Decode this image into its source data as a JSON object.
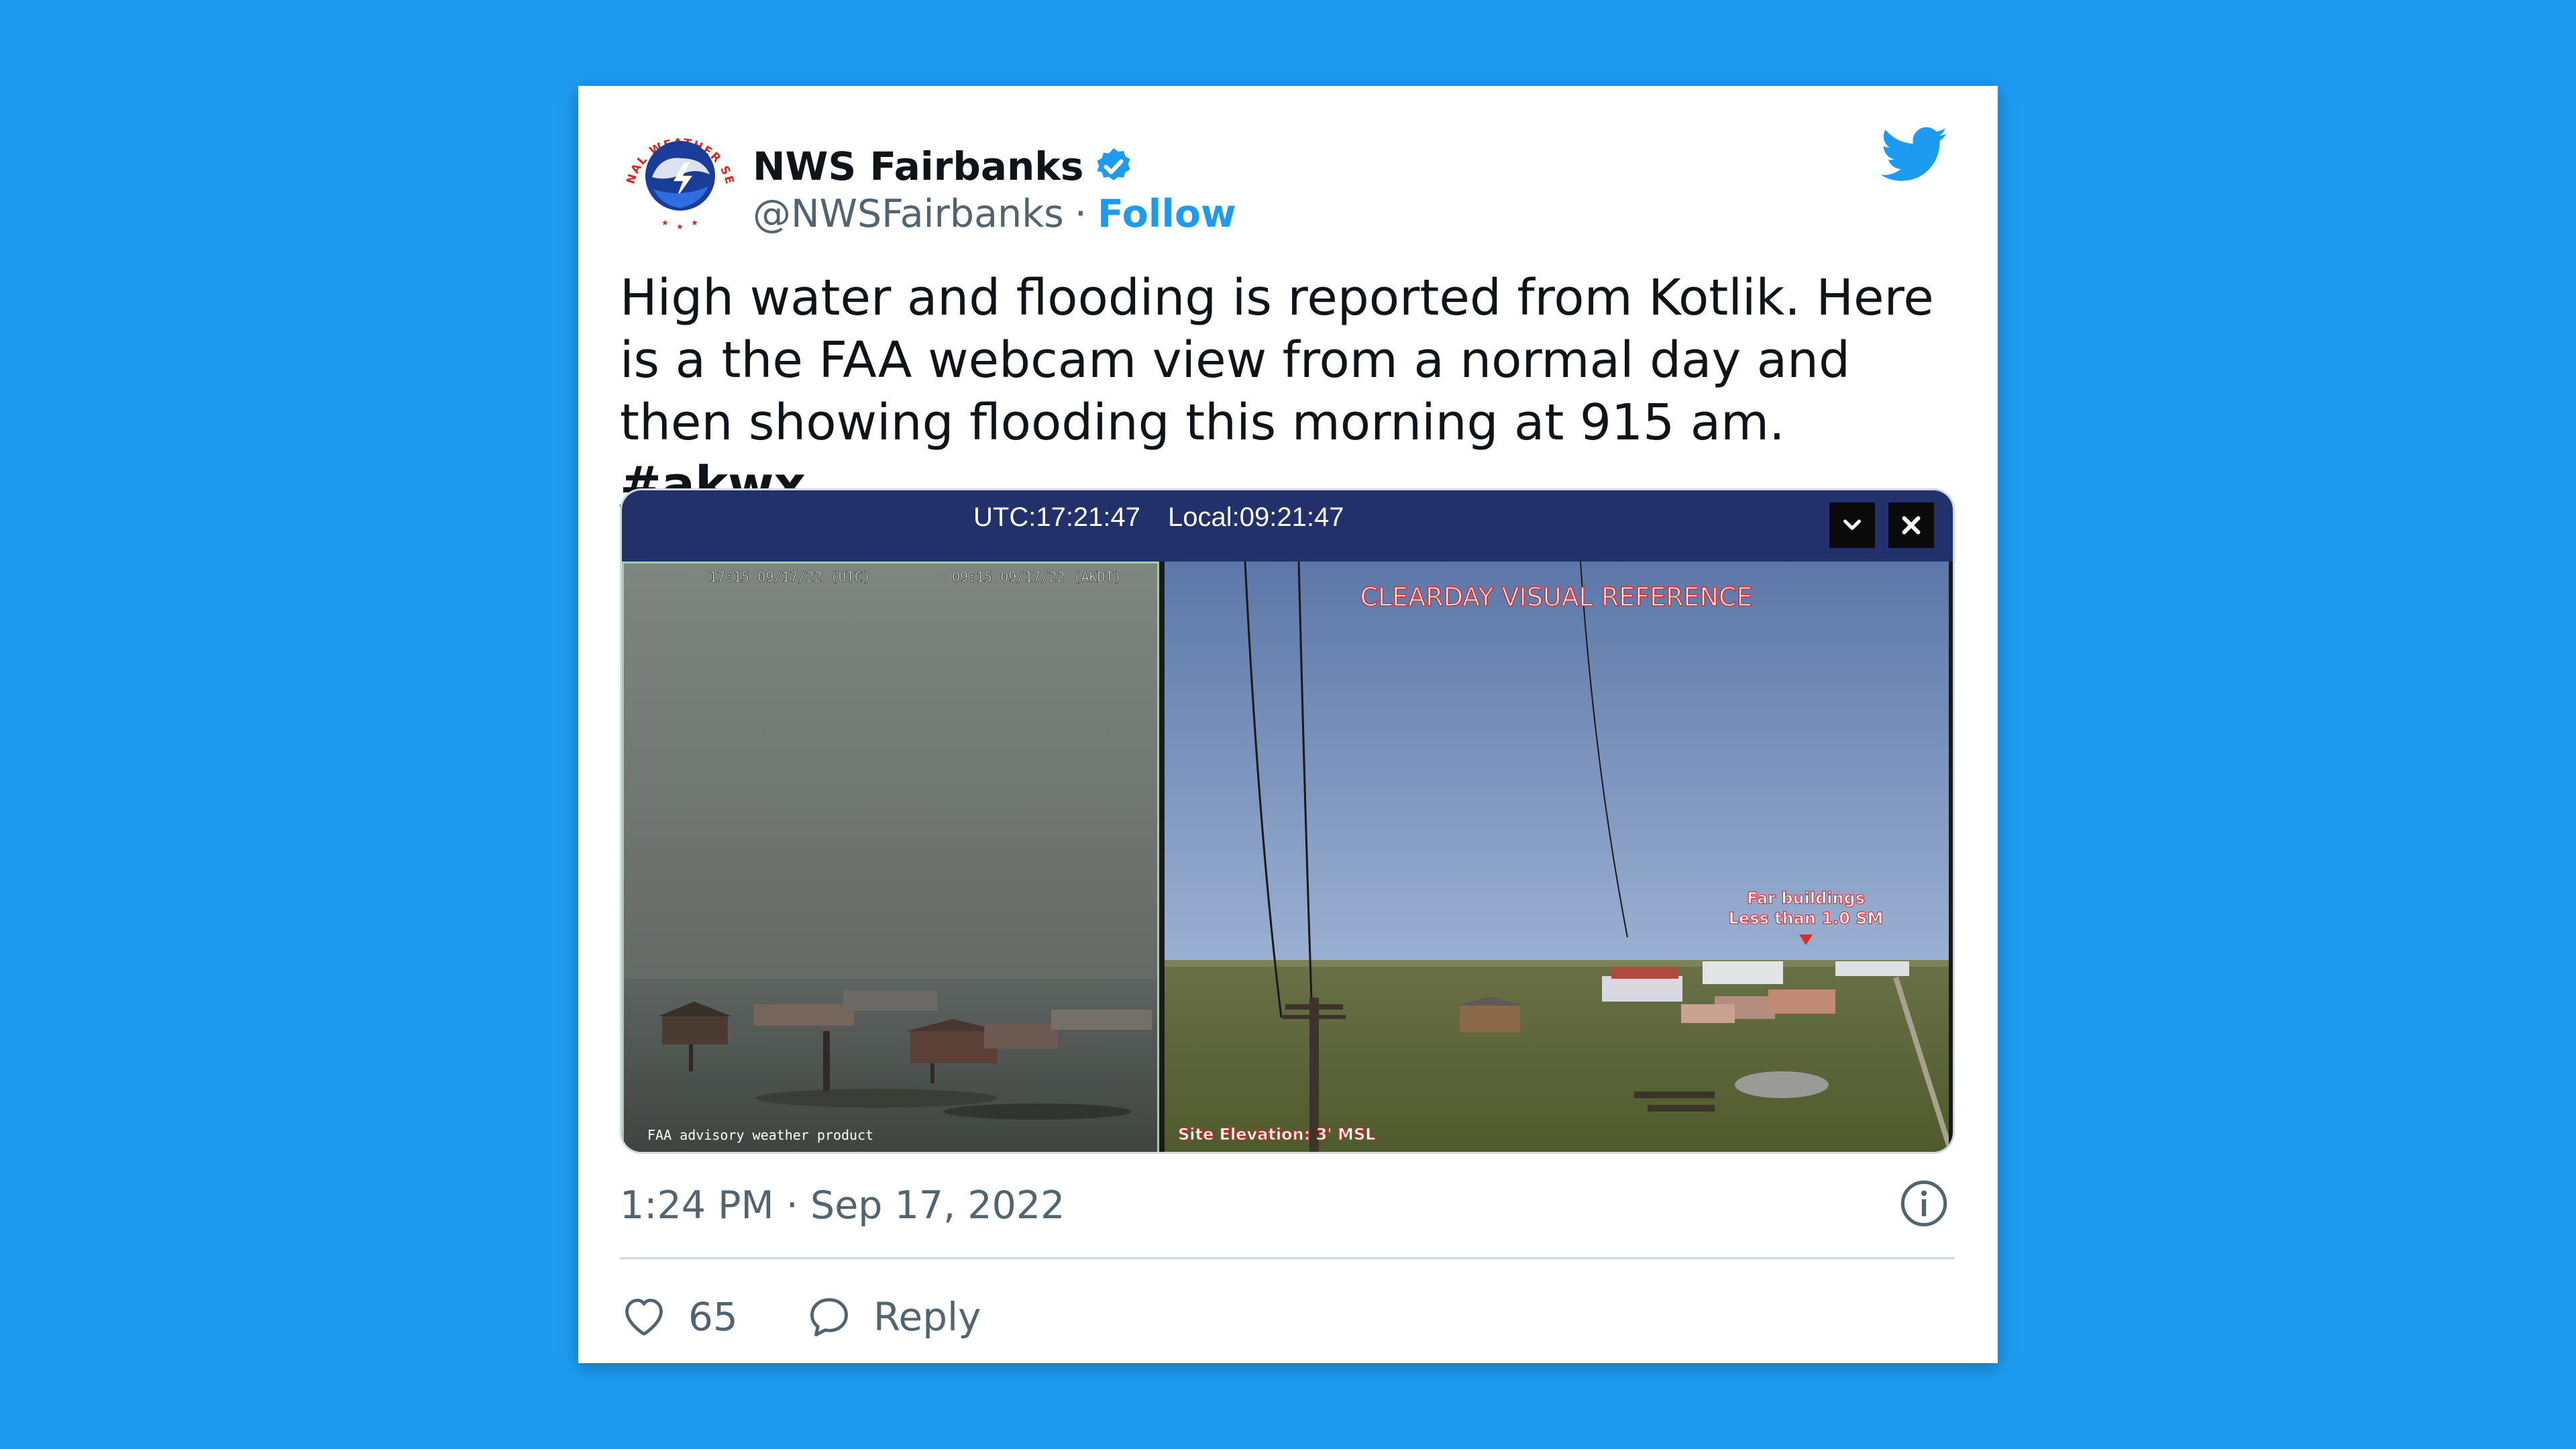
{
  "tweet": {
    "display_name": "NWS Fairbanks",
    "handle": "@NWSFairbanks",
    "separator": "·",
    "follow_label": "Follow",
    "text": "High water and flooding is reported from Kotlik. Here is a the FAA webcam view from a normal day and then showing flooding this morning at 915 am. ",
    "hashtag": "#akwx",
    "timestamp": "1:24 PM · Sep 17, 2022",
    "likes": "65",
    "reply_label": "Reply"
  },
  "avatar": {
    "logo_text": "NATIONAL WEATHER SERVICE"
  },
  "webcam": {
    "utc_time": "UTC:17:21:47",
    "local_time": "Local:09:21:47",
    "left_stamp_utc": "17:15 09/17/22 (UTC)",
    "left_stamp_local": "09:15 09/17/22 (AKDT)",
    "left_caption": "FAA advisory weather product",
    "right_title": "CLEARDAY VISUAL REFERENCE",
    "right_label_line1": "Far buildings",
    "right_label_line2": "Less than 1.0 SM",
    "right_caption": "Site Elevation: 3' MSL"
  },
  "colors": {
    "background": "#1d9bf0",
    "card": "#ffffff",
    "text": "#0f1419",
    "secondary": "#536471",
    "link": "#1d9bf0",
    "webcam_bar": "#22306b"
  },
  "icons": {
    "avatar": "nws-logo-icon",
    "verified": "verified-badge-icon",
    "brand": "twitter-bird-icon",
    "info": "info-icon",
    "like": "heart-icon",
    "reply": "reply-bubble-icon",
    "webcam_collapse": "chevron-down-icon",
    "webcam_close": "close-icon"
  }
}
